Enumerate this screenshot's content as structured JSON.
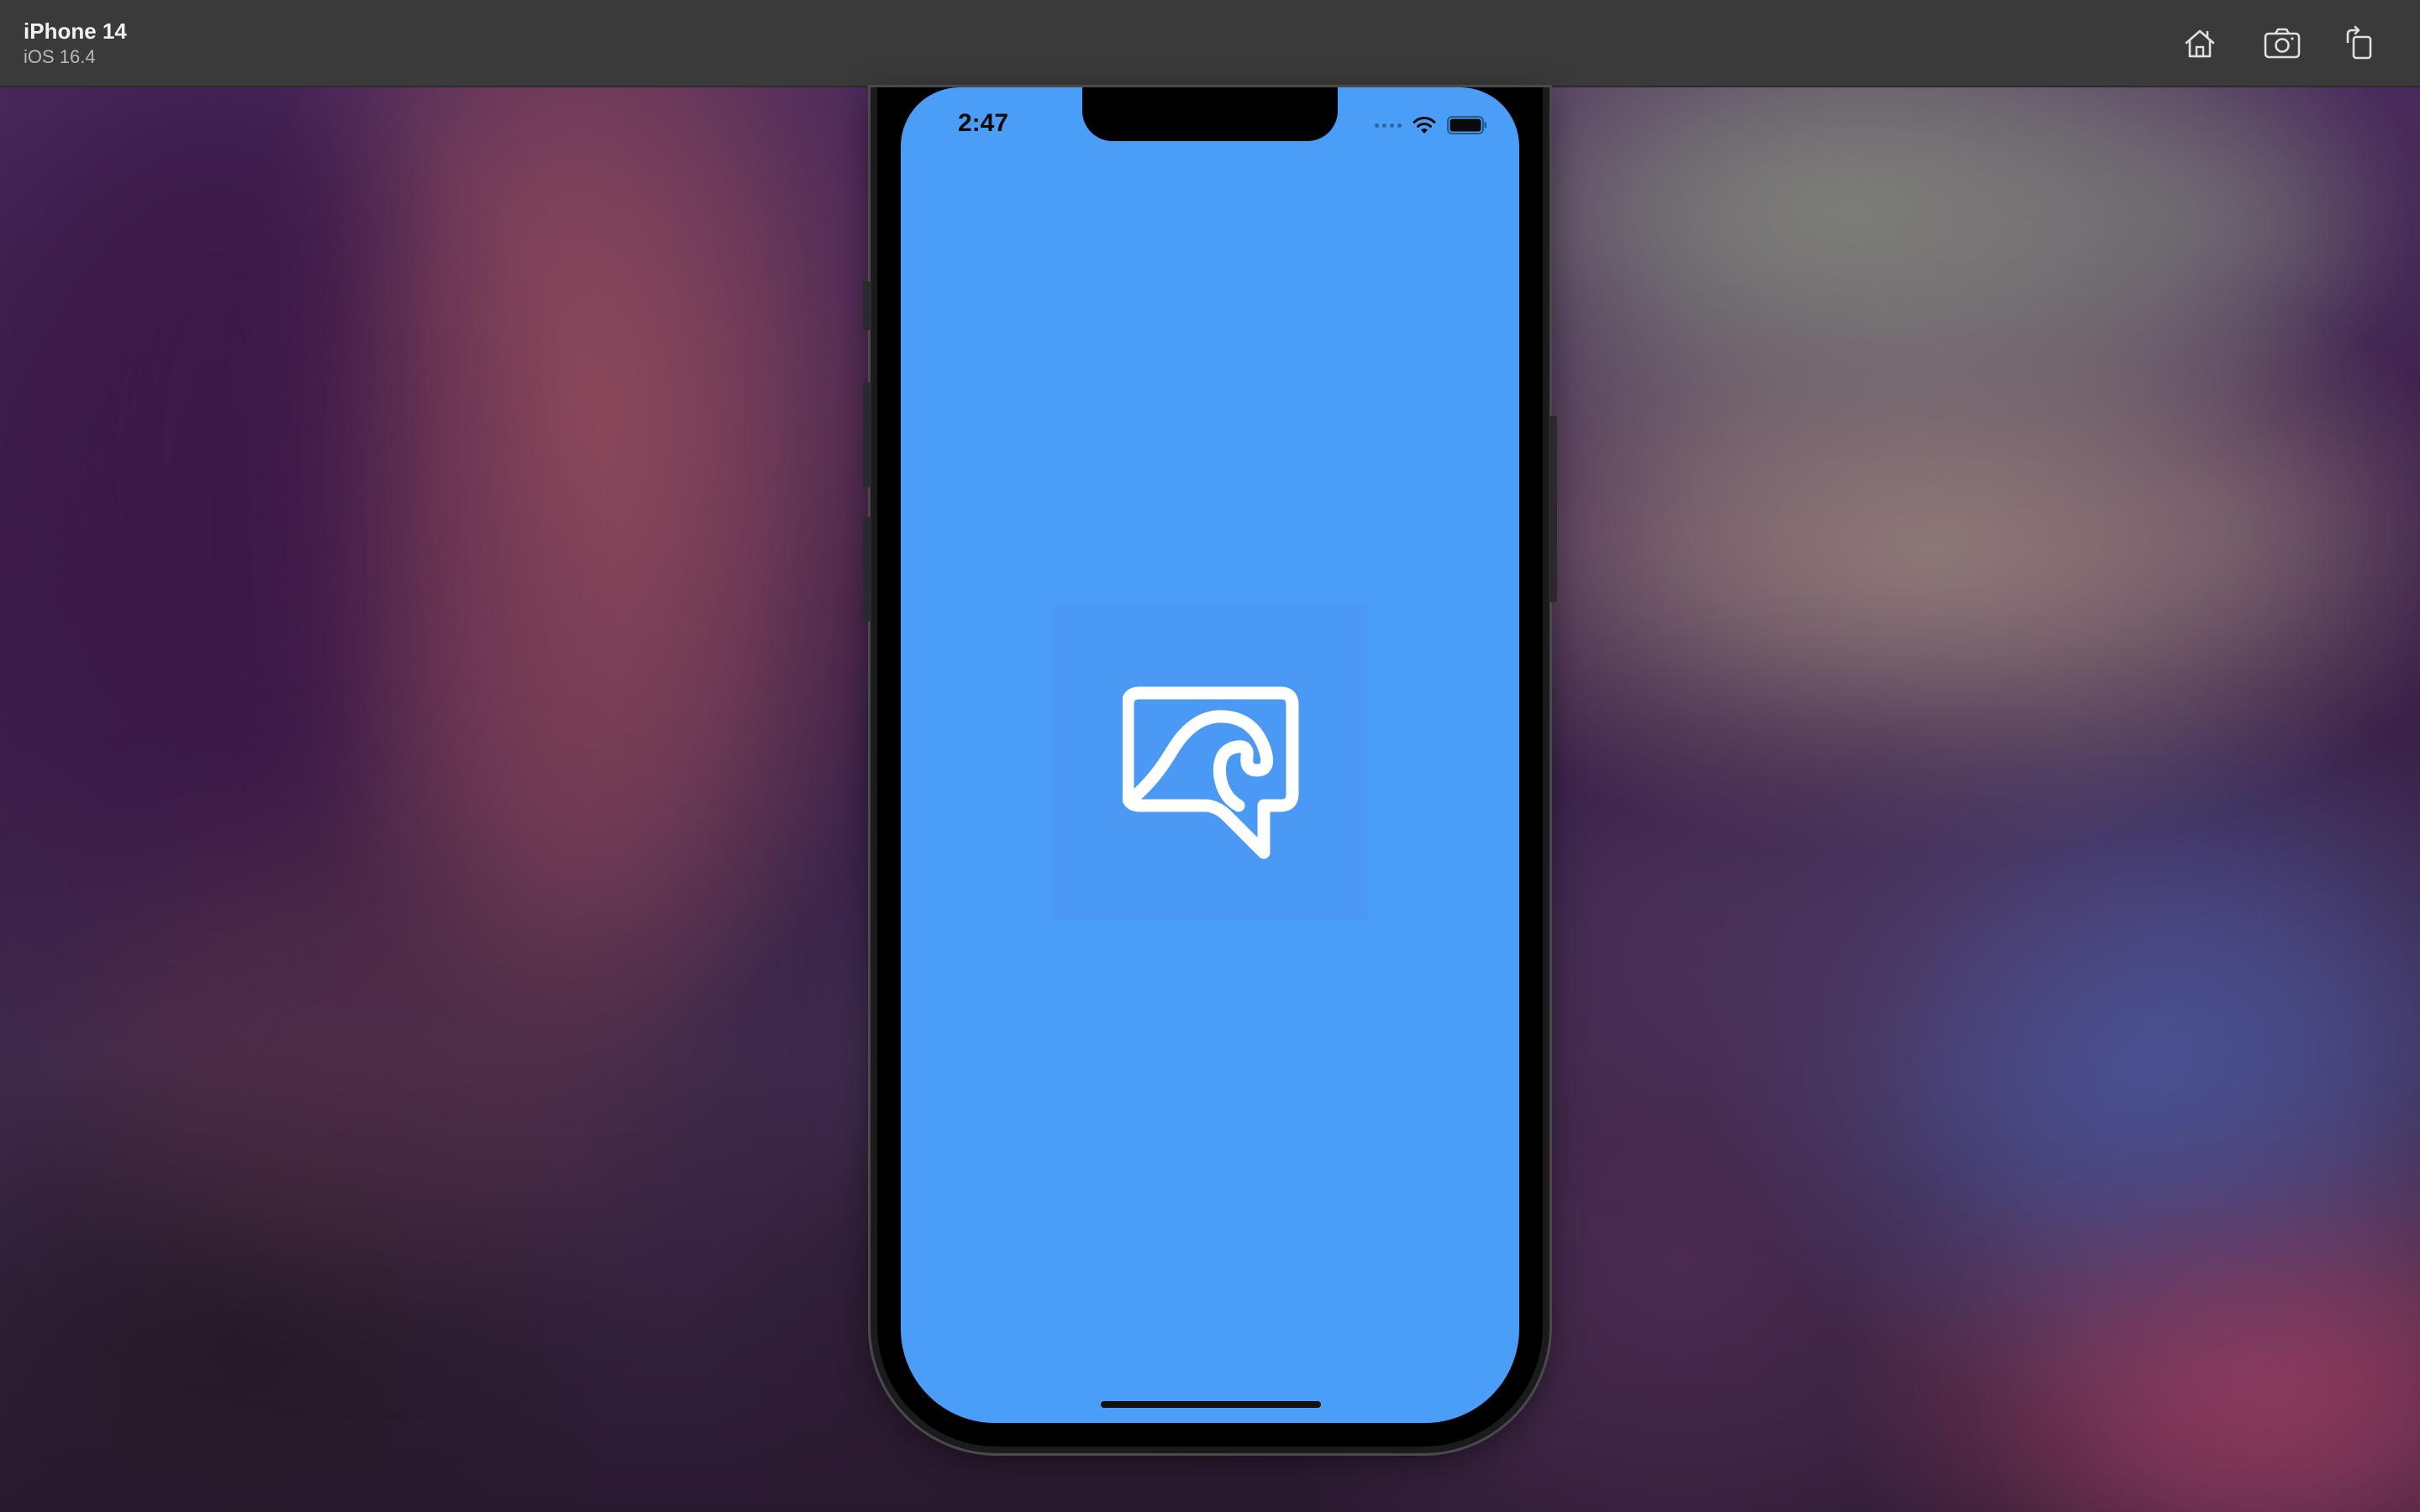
{
  "titlebar": {
    "device_name": "iPhone 14",
    "os_version": "iOS 16.4",
    "buttons": [
      {
        "name": "home-button",
        "icon": "home-icon"
      },
      {
        "name": "screenshot-button",
        "icon": "camera-icon"
      },
      {
        "name": "rotate-button",
        "icon": "rotate-icon"
      }
    ]
  },
  "status_bar": {
    "time": "2:47",
    "icons": [
      "cellular-dots-icon",
      "wifi-icon",
      "battery-icon"
    ]
  },
  "splash": {
    "background_color": "#4b9ef7",
    "logo_icon": "app-logo-icon"
  },
  "colors": {
    "titlebar": "#3a3a3a",
    "screen": "#4b9ef7",
    "logo": "#ffffff"
  }
}
